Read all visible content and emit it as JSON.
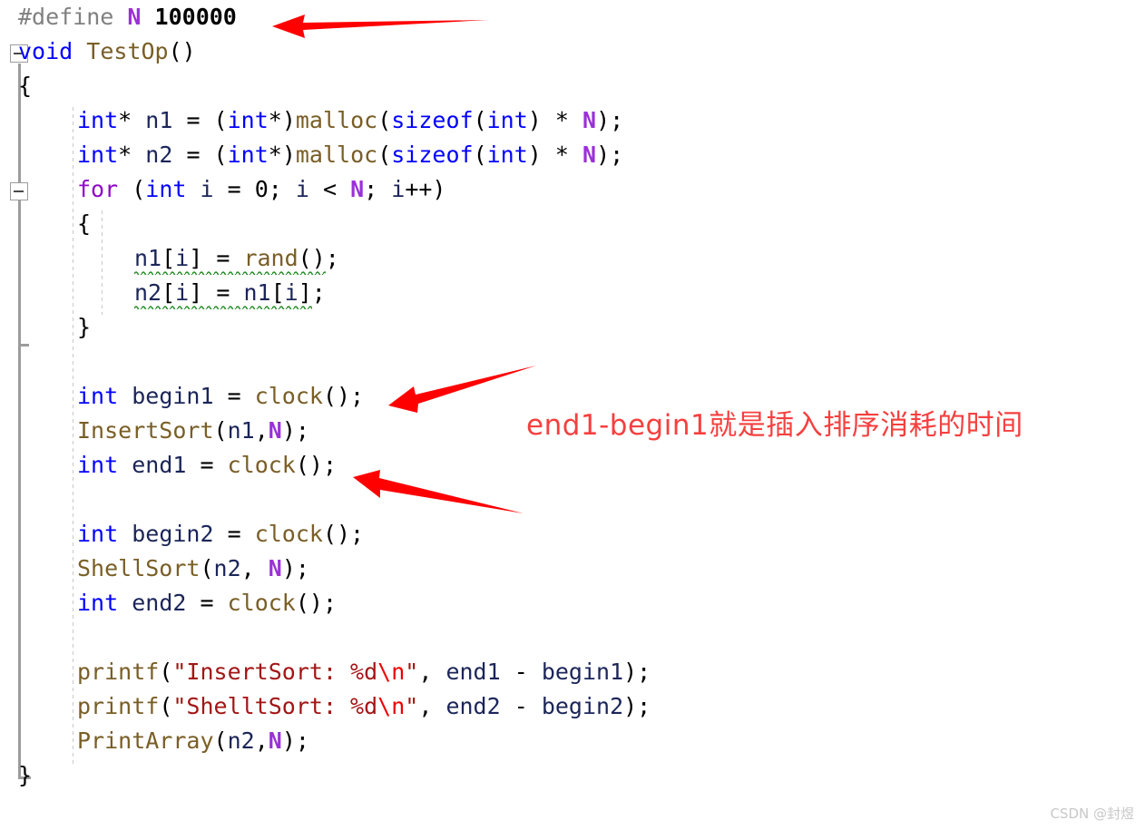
{
  "editor": {
    "language": "C",
    "background": "#ffffff",
    "colors": {
      "preprocessor": "#808080",
      "macro": "#9B30D9",
      "number": "#000000",
      "keyword": "#0000FF",
      "control_keyword": "#8F08C4",
      "function": "#795E26",
      "identifier": "#1B2559",
      "string": "#A31515",
      "escape": "#EE0000",
      "squiggle": "#228B22",
      "outline_line": "#9C9C9C",
      "indent_guide": "#C8C8C8"
    },
    "lines": [
      {
        "n": 1,
        "indent": 0,
        "text": "#define N 100000"
      },
      {
        "n": 2,
        "indent": 0,
        "text": "void TestOp()"
      },
      {
        "n": 3,
        "indent": 0,
        "text": "{"
      },
      {
        "n": 4,
        "indent": 1,
        "text": "int* n1 = (int*)malloc(sizeof(int) * N);"
      },
      {
        "n": 5,
        "indent": 1,
        "text": "int* n2 = (int*)malloc(sizeof(int) * N);"
      },
      {
        "n": 6,
        "indent": 1,
        "text": "for (int i = 0; i < N; i++)"
      },
      {
        "n": 7,
        "indent": 1,
        "text": "{"
      },
      {
        "n": 8,
        "indent": 2,
        "text": "n1[i] = rand();"
      },
      {
        "n": 9,
        "indent": 2,
        "text": "n2[i] = n1[i];"
      },
      {
        "n": 10,
        "indent": 1,
        "text": "}"
      },
      {
        "n": 11,
        "indent": 1,
        "text": ""
      },
      {
        "n": 12,
        "indent": 1,
        "text": "int begin1 = clock();"
      },
      {
        "n": 13,
        "indent": 1,
        "text": "InsertSort(n1,N);"
      },
      {
        "n": 14,
        "indent": 1,
        "text": "int end1 = clock();"
      },
      {
        "n": 15,
        "indent": 1,
        "text": ""
      },
      {
        "n": 16,
        "indent": 1,
        "text": "int begin2 = clock();"
      },
      {
        "n": 17,
        "indent": 1,
        "text": "ShellSort(n2, N);"
      },
      {
        "n": 18,
        "indent": 1,
        "text": "int end2 = clock();"
      },
      {
        "n": 19,
        "indent": 1,
        "text": ""
      },
      {
        "n": 20,
        "indent": 1,
        "text": "printf(\"InsertSort: %d\\n\", end1 - begin1);"
      },
      {
        "n": 21,
        "indent": 1,
        "text": "printf(\"ShelltSort: %d\\n\", end2 - begin2);"
      },
      {
        "n": 22,
        "indent": 1,
        "text": "PrintArray(n2,N);"
      },
      {
        "n": 23,
        "indent": 0,
        "text": "}"
      }
    ],
    "tokens": {
      "define_directive": "#define",
      "macro_name": "N",
      "macro_value": "100000",
      "kw_void": "void",
      "fn_testop": "TestOp",
      "kw_int": "int",
      "kw_sizeof": "sizeof",
      "fn_malloc": "malloc",
      "fn_rand": "rand",
      "fn_clock": "clock",
      "fn_insertsort": "InsertSort",
      "fn_shellsort": "ShellSort",
      "fn_printf": "printf",
      "fn_printarray": "PrintArray",
      "ctrl_for": "for",
      "var_n1": "n1",
      "var_n2": "n2",
      "var_i": "i",
      "var_begin1": "begin1",
      "var_end1": "end1",
      "var_begin2": "begin2",
      "var_end2": "end2",
      "str_insertsort": "\"InsertSort: %d",
      "str_shelltsort": "\"ShelltSort: %d",
      "esc_newline": "\\n",
      "str_close": "\""
    },
    "squiggle_errors": [
      {
        "line": 8,
        "text": "n1[i] = rand();"
      },
      {
        "line": 9,
        "text": "n2[i] = n1[i];"
      }
    ],
    "outlining": {
      "markers": [
        {
          "name": "collapse-function-TestOp",
          "line": 2,
          "state": "expanded",
          "glyph": "minus"
        },
        {
          "name": "collapse-for-loop",
          "line": 6,
          "state": "expanded",
          "glyph": "minus"
        }
      ]
    }
  },
  "annotations": {
    "note_text": "end1-begin1就是插入排序消耗的时间",
    "note_color": "#F5403F",
    "arrows": [
      {
        "name": "arrow-to-define-line",
        "points_to": "#define N 100000",
        "direction": "left"
      },
      {
        "name": "arrow-to-begin1-clock",
        "points_to": "int begin1 = clock();",
        "direction": "left-up"
      },
      {
        "name": "arrow-to-end1-clock",
        "points_to": "int end1 = clock();",
        "direction": "left-down"
      }
    ]
  },
  "watermark": {
    "text": "CSDN @封煜"
  }
}
